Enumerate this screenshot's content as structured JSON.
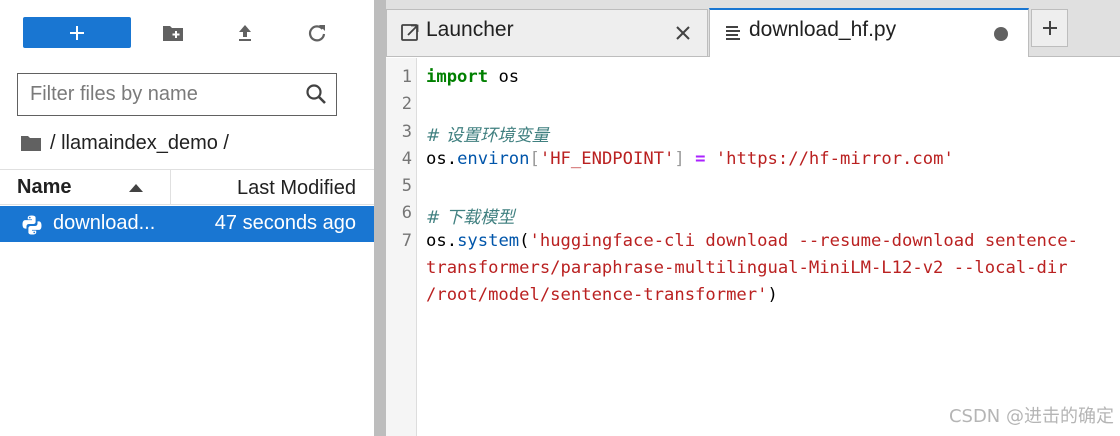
{
  "filebrowser": {
    "filter_placeholder": "Filter files by name",
    "breadcrumb": "/ llamaindex_demo /",
    "columns": {
      "name": "Name",
      "modified": "Last Modified"
    },
    "files": [
      {
        "name": "download...",
        "modified": "47 seconds ago",
        "selected": true
      }
    ]
  },
  "tabs": [
    {
      "label": "Launcher",
      "icon": "launcher-icon",
      "active": false
    },
    {
      "label": "download_hf.py",
      "icon": "text-file-icon",
      "active": true,
      "unsaved": true
    }
  ],
  "editor": {
    "line_numbers": [
      "1",
      "2",
      "3",
      "4",
      "5",
      "6",
      "7"
    ],
    "code": {
      "l1_kw": "import",
      "l1_rest": " os",
      "l3_comment": "# 设置环境变量",
      "l4_obj": "os",
      "l4_dot": ".",
      "l4_attr": "environ",
      "l4_lb": "[",
      "l4_key": "'HF_ENDPOINT'",
      "l4_rb": "]",
      "l4_eq": " = ",
      "l4_val": "'https://hf-mirror.com'",
      "l6_comment": "# 下载模型",
      "l7_obj": "os",
      "l7_dot": ".",
      "l7_attr": "system",
      "l7_lp": "(",
      "l7_str1": "'huggingface-cli download --resume-download sentence-",
      "l7_str2": "transformers/paraphrase-multilingual-MiniLM-L12-v2 --local-dir",
      "l7_str3": "/root/model/sentence-transformer'",
      "l7_rp": ")"
    }
  },
  "watermark": "CSDN @进击的确定",
  "colors": {
    "accent": "#1976d2",
    "keyword": "#008000",
    "string": "#ba2121",
    "comment": "#408080"
  }
}
